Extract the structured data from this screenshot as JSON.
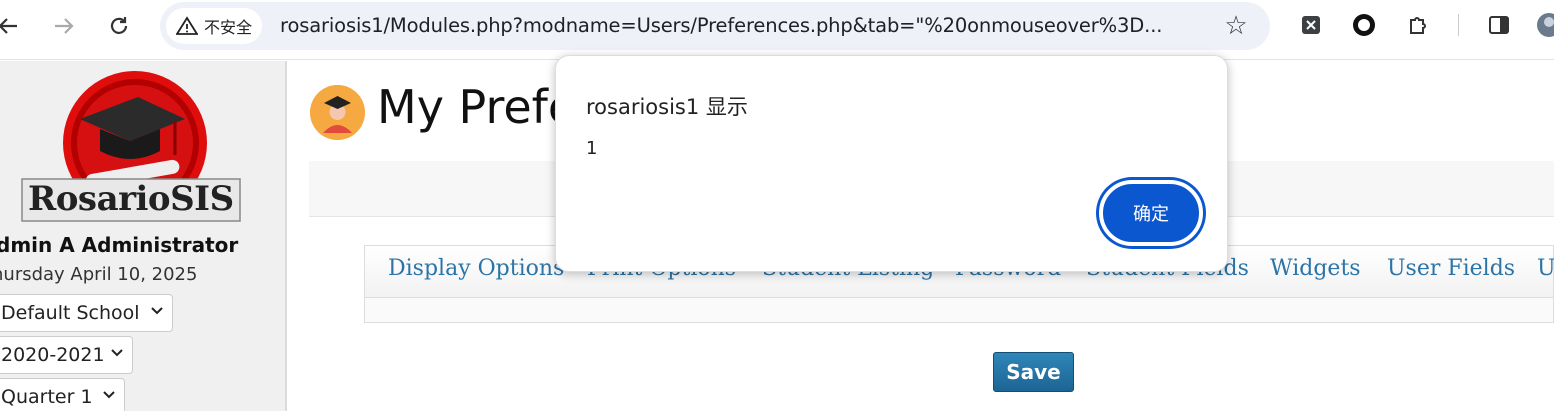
{
  "browser": {
    "security_label": "不安全",
    "url": "rosariosis1/Modules.php?modname=Users/Preferences.php&tab=\"%20onmouseover%3D...",
    "icons": [
      "back-icon",
      "forward-icon",
      "reload-icon",
      "warning-icon",
      "star-icon",
      "extension-x-icon",
      "record-icon",
      "puzzle-icon",
      "sidepanel-icon",
      "profile-icon"
    ]
  },
  "sidebar": {
    "logo_text": "RosarioSIS",
    "user_name": "dmin A Administrator",
    "date": "hursday April 10, 2025",
    "school_select": "Default School",
    "year_select": "2020-2021",
    "quarter_select": "Quarter 1"
  },
  "main": {
    "title": "My Prefe",
    "tabs": [
      {
        "label": "Display Options"
      },
      {
        "label": "Print Options"
      },
      {
        "label": "Student Listing"
      },
      {
        "label": "Password"
      },
      {
        "label": "Student Fields"
      },
      {
        "label": "Widgets"
      },
      {
        "label": "User Fields"
      },
      {
        "label": "U"
      }
    ],
    "save_label": "Save"
  },
  "dialog": {
    "title": "rosariosis1 显示",
    "message": "1",
    "ok_label": "确定"
  },
  "colors": {
    "tab_link": "#2b74a8",
    "ok_button": "#0b57d0",
    "save_button": "#1c6594"
  }
}
